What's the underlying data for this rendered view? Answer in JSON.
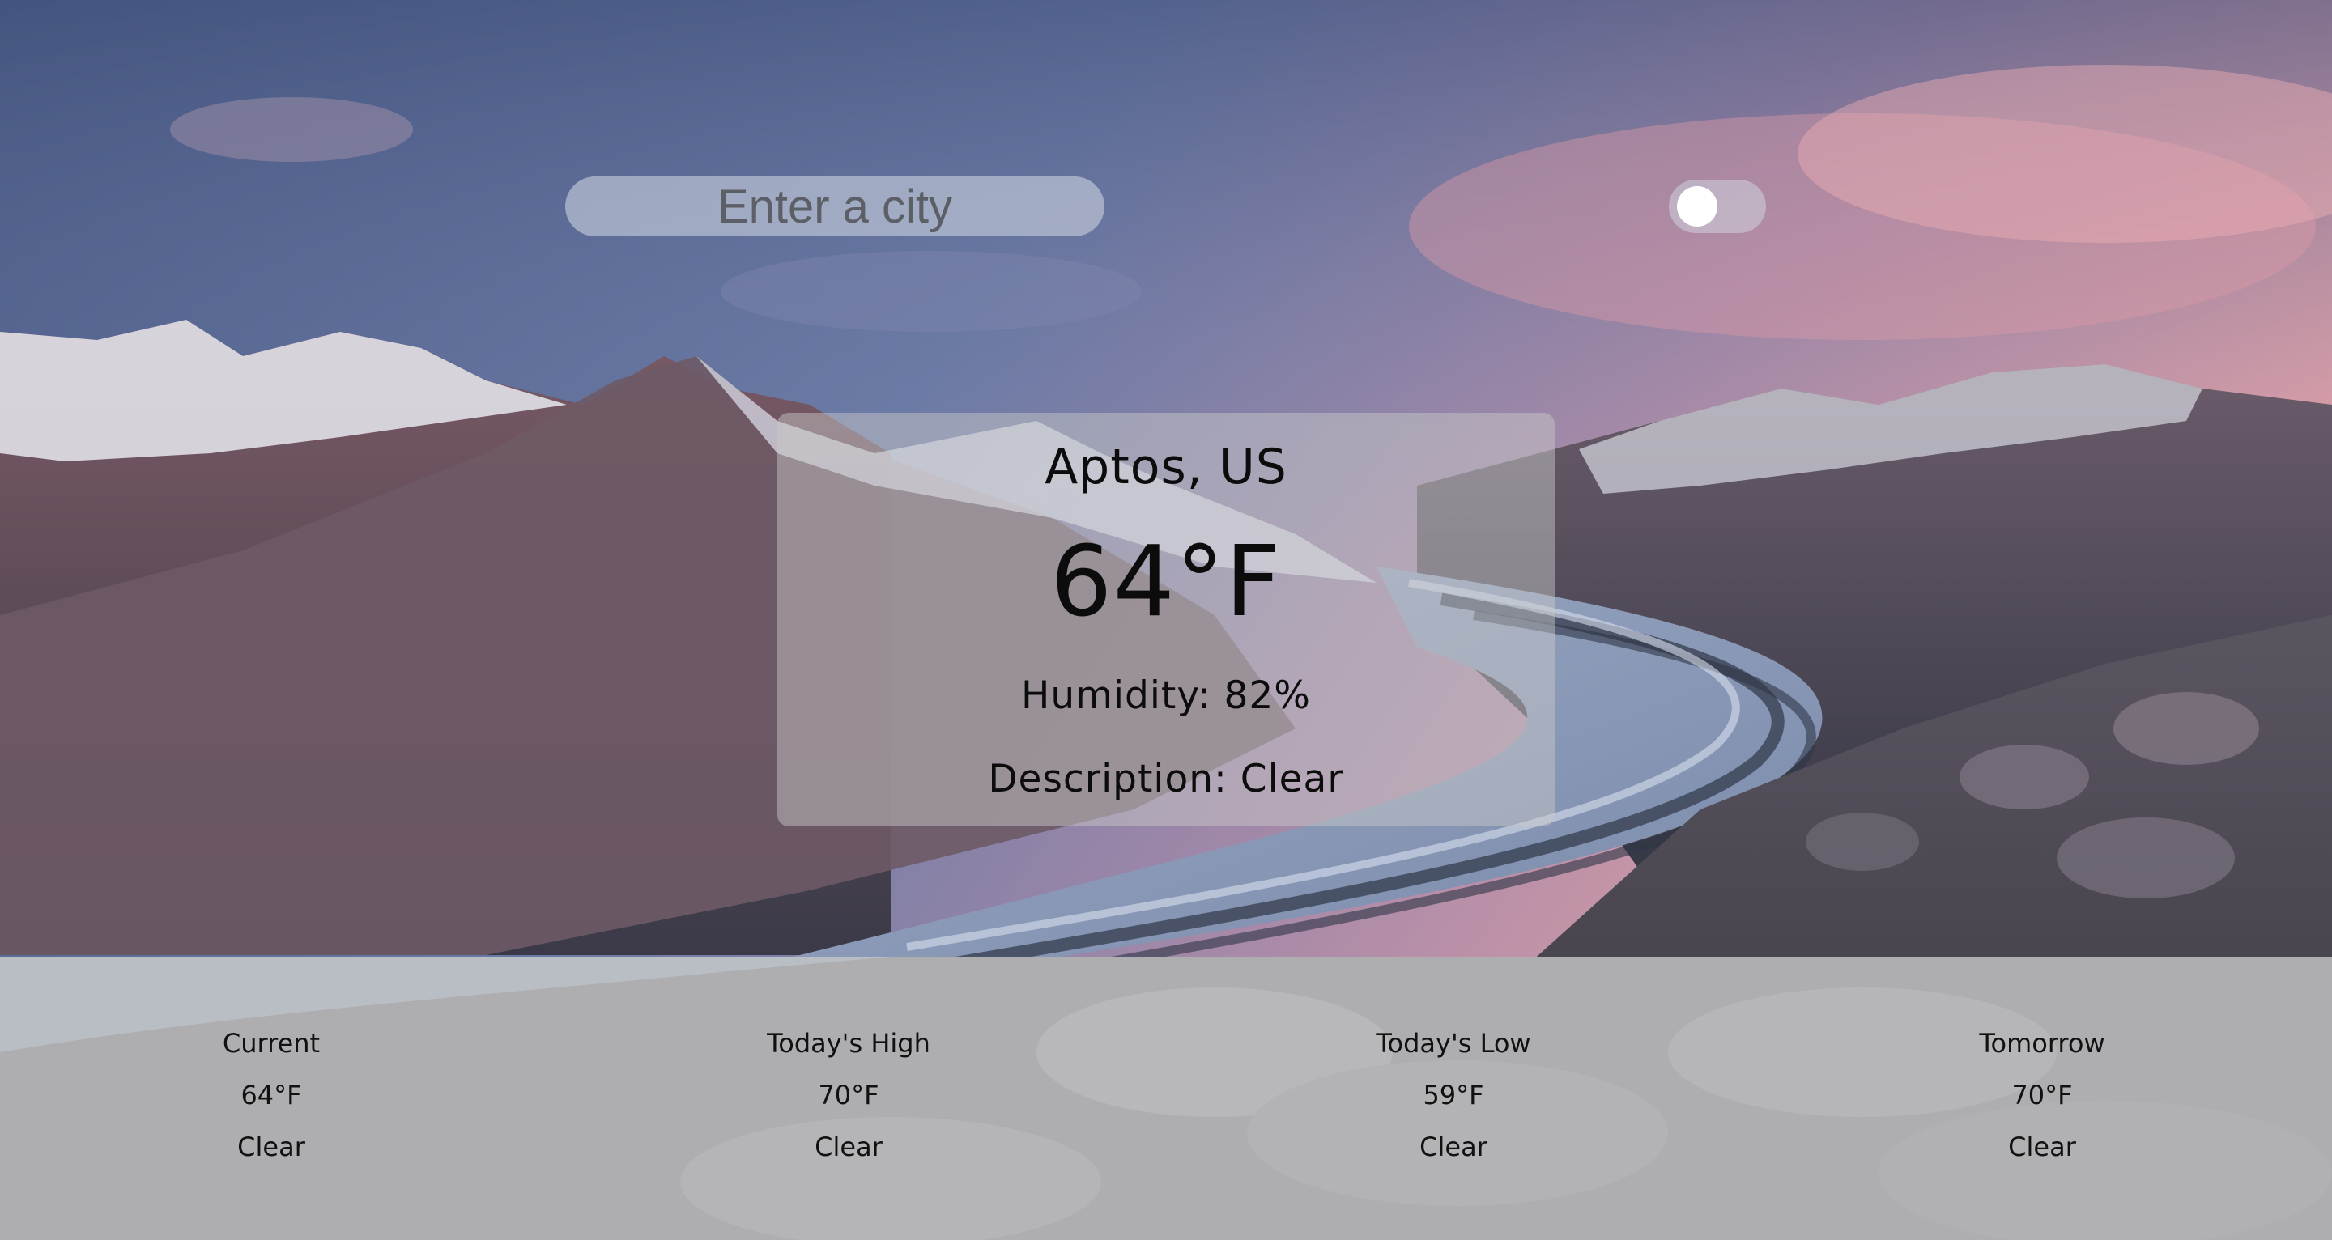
{
  "search": {
    "placeholder": "Enter a city"
  },
  "toggle": {
    "state": "off"
  },
  "current_weather": {
    "city": "Aptos, US",
    "temperature": "64°F",
    "humidity": "Humidity: 82%",
    "description": "Description: Clear"
  },
  "forecast": [
    {
      "label": "Current",
      "temp": "64°F",
      "desc": "Clear"
    },
    {
      "label": "Today's High",
      "temp": "70°F",
      "desc": "Clear"
    },
    {
      "label": "Today's Low",
      "temp": "59°F",
      "desc": "Clear"
    },
    {
      "label": "Tomorrow",
      "temp": "70°F",
      "desc": "Clear"
    }
  ]
}
